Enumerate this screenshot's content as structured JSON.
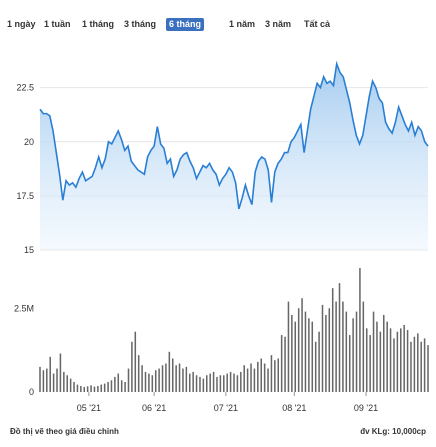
{
  "range_buttons": [
    {
      "label": "1 ngày",
      "active": false
    },
    {
      "label": "1 tuần",
      "active": false
    },
    {
      "label": "1 tháng",
      "active": false
    },
    {
      "label": "3 tháng",
      "active": false
    },
    {
      "label": "6 tháng",
      "active": true
    },
    {
      "label": "1 năm",
      "active": false
    },
    {
      "label": "3 năm",
      "active": false
    },
    {
      "label": "Tất cả",
      "active": false
    }
  ],
  "footer": {
    "left": "Đồ thị vẽ theo giá điều chỉnh",
    "right": "đv KLg: 10,000cp"
  },
  "colors": {
    "price_line": "#2a7fd4",
    "price_fill_top": "#9cc7ee",
    "price_fill_bottom": "#eaf4fd",
    "volume_bar": "#666666",
    "grid": "#e6e6e6"
  },
  "chart_data": [
    {
      "type": "area",
      "title": "",
      "ylim": [
        15,
        23.5
      ],
      "yticks": [
        15,
        17.5,
        20,
        22.5
      ],
      "ytick_labels": [
        "15",
        "17.5",
        "20",
        "22.5"
      ],
      "xtick_labels": [
        "05 '21",
        "06 '21",
        "07 '21",
        "08 '21",
        "09 '21"
      ],
      "xtick_index": [
        15,
        35,
        57,
        78,
        100
      ],
      "grid": true,
      "values": [
        21.5,
        21.3,
        21.3,
        21.2,
        20.5,
        19.5,
        18.5,
        17.3,
        18.2,
        18.0,
        18.1,
        17.9,
        18.3,
        18.6,
        18.2,
        18.3,
        18.4,
        18.8,
        19.3,
        18.8,
        19.2,
        20.0,
        19.9,
        20.2,
        20.5,
        20.1,
        19.6,
        19.8,
        19.1,
        18.9,
        18.7,
        18.6,
        18.5,
        19.3,
        19.6,
        19.8,
        20.7,
        19.9,
        19.7,
        19.0,
        19.2,
        18.4,
        18.7,
        19.2,
        19.4,
        19.5,
        19.1,
        18.8,
        18.3,
        18.6,
        18.9,
        18.8,
        19.0,
        18.7,
        18.5,
        18.0,
        18.3,
        18.5,
        18.8,
        18.6,
        18.1,
        16.9,
        17.4,
        18.0,
        17.5,
        17.1,
        18.6,
        19.1,
        19.3,
        19.2,
        18.7,
        17.2,
        18.6,
        19.0,
        19.2,
        19.5,
        19.5,
        20.0,
        20.2,
        20.5,
        20.8,
        19.5,
        20.5,
        21.5,
        22.1,
        22.7,
        22.5,
        23.0,
        22.7,
        22.8,
        22.6,
        23.6,
        23.2,
        23.0,
        22.4,
        21.8,
        21.0,
        20.3,
        19.9,
        20.3,
        21.2,
        22.1,
        22.8,
        22.5,
        22.0,
        21.8,
        20.9,
        20.6,
        20.4,
        20.9,
        21.6,
        21.2,
        20.8,
        20.5,
        20.9,
        20.3,
        20.7,
        20.5,
        20.0,
        19.8
      ]
    },
    {
      "type": "bar",
      "title": "",
      "ylim": [
        0,
        4000000
      ],
      "yticks": [
        0,
        2500000
      ],
      "ytick_labels": [
        "0",
        "2.5M"
      ],
      "xtick_labels": [
        "05 '21",
        "06 '21",
        "07 '21",
        "08 '21",
        "09 '21"
      ],
      "xtick_index": [
        15,
        35,
        57,
        78,
        100
      ],
      "values": [
        750000,
        650000,
        700000,
        1050000,
        550000,
        700000,
        1150000,
        600000,
        500000,
        400000,
        300000,
        220000,
        180000,
        150000,
        170000,
        200000,
        160000,
        180000,
        220000,
        250000,
        300000,
        350000,
        450000,
        550000,
        350000,
        300000,
        700000,
        1500000,
        1800000,
        1100000,
        800000,
        600000,
        550000,
        500000,
        650000,
        700000,
        800000,
        850000,
        1200000,
        1000000,
        800000,
        850000,
        700000,
        750000,
        550000,
        600000,
        500000,
        450000,
        400000,
        500000,
        550000,
        600000,
        450000,
        500000,
        500000,
        550000,
        600000,
        550000,
        500000,
        600000,
        800000,
        700000,
        850000,
        700000,
        900000,
        1000000,
        850000,
        700000,
        1100000,
        950000,
        1000000,
        1700000,
        1650000,
        2700000,
        2300000,
        2100000,
        2500000,
        2800000,
        2400000,
        2200000,
        2100000,
        1500000,
        1800000,
        2600000,
        2300000,
        2500000,
        3100000,
        2700000,
        3250000,
        2700000,
        2400000,
        1700000,
        2200000,
        2400000,
        3700000,
        2700000,
        1900000,
        1700000,
        2400000,
        2100000,
        1800000,
        2300000,
        2100000,
        1900000,
        1600000,
        1800000,
        1900000,
        2000000,
        1850000,
        1500000,
        1650000,
        1750000,
        1500000,
        1600000,
        1400000
      ]
    }
  ]
}
